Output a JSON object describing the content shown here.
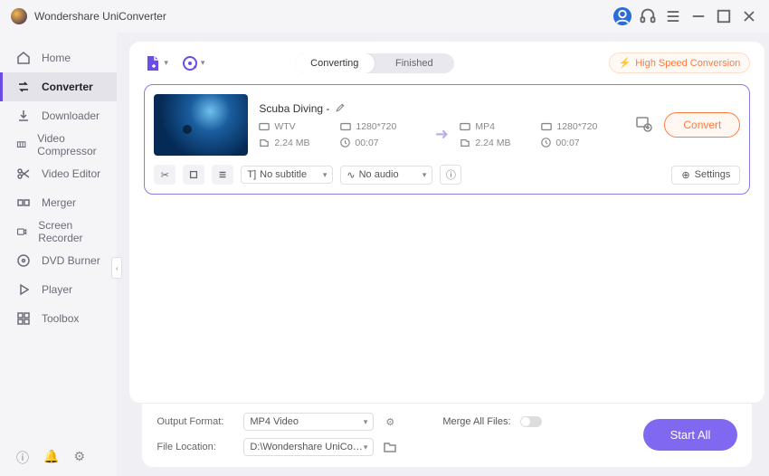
{
  "app_title": "Wondershare UniConverter",
  "window_controls": {
    "avatar_icon": "user",
    "support_icon": "headset",
    "menu_icon": "menu"
  },
  "sidebar": {
    "items": [
      {
        "label": "Home",
        "icon": "home"
      },
      {
        "label": "Converter",
        "icon": "converter",
        "active": true
      },
      {
        "label": "Downloader",
        "icon": "download"
      },
      {
        "label": "Video Compressor",
        "icon": "compress"
      },
      {
        "label": "Video Editor",
        "icon": "scissors"
      },
      {
        "label": "Merger",
        "icon": "merge"
      },
      {
        "label": "Screen Recorder",
        "icon": "record"
      },
      {
        "label": "DVD Burner",
        "icon": "dvd"
      },
      {
        "label": "Player",
        "icon": "play"
      },
      {
        "label": "Toolbox",
        "icon": "grid"
      }
    ]
  },
  "tabs": {
    "converting": "Converting",
    "finished": "Finished",
    "active": "converting"
  },
  "high_speed": "High Speed Conversion",
  "item": {
    "title": "Scuba Diving -",
    "source": {
      "format": "WTV",
      "resolution": "1280*720",
      "size": "2.24 MB",
      "duration": "00:07"
    },
    "target": {
      "format": "MP4",
      "resolution": "1280*720",
      "size": "2.24 MB",
      "duration": "00:07"
    },
    "convert_btn": "Convert",
    "subtitle": "No subtitle",
    "audio": "No audio",
    "settings": "Settings"
  },
  "bottom": {
    "output_format_label": "Output Format:",
    "output_format_value": "MP4 Video",
    "file_location_label": "File Location:",
    "file_location_value": "D:\\Wondershare UniConverter",
    "merge_label": "Merge All Files:",
    "start_all": "Start All"
  }
}
